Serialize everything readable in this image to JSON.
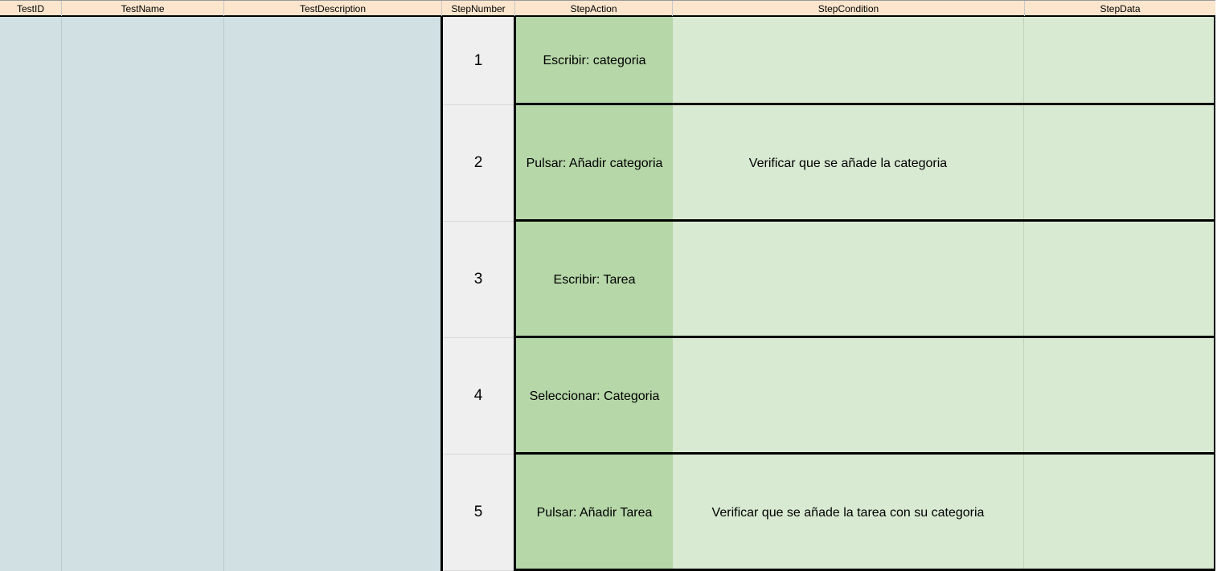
{
  "headers": [
    "TestID",
    "TestName",
    "TestDescription",
    "StepNumber",
    "StepAction",
    "StepCondition",
    "StepData"
  ],
  "colors": {
    "header_bg": "#fce5cd",
    "left_bg": "#d0e0e3",
    "step_number_bg": "#efefef",
    "step_action_bg": "#b6d7a8",
    "step_condition_bg": "#d9ead3"
  },
  "steps": [
    {
      "number": "1",
      "action": "Escribir: categoria",
      "condition": "",
      "data": ""
    },
    {
      "number": "2",
      "action": "Pulsar: Añadir categoria",
      "condition": "Verificar que se añade la categoria",
      "data": ""
    },
    {
      "number": "3",
      "action": "Escribir: Tarea",
      "condition": "",
      "data": ""
    },
    {
      "number": "4",
      "action": "Seleccionar: Categoria",
      "condition": "",
      "data": ""
    },
    {
      "number": "5",
      "action": "Pulsar: Añadir Tarea",
      "condition": "Verificar que se añade la tarea con su categoria",
      "data": ""
    }
  ]
}
